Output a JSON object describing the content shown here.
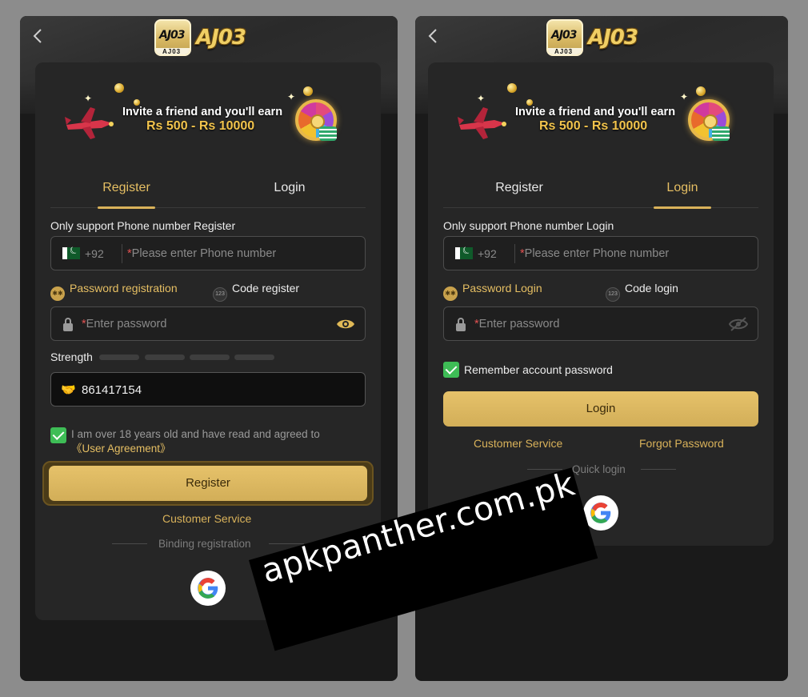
{
  "colors": {
    "gold": "#d9b25a",
    "card": "#262626",
    "check": "#3ebd56"
  },
  "brand": {
    "icon_mark": "AJ03",
    "icon_small": "AJ03",
    "word": "AJ03"
  },
  "banner": {
    "line1": "Invite a friend and you'll earn",
    "line2": "Rs 500 - Rs 10000"
  },
  "register_screen": {
    "tabs": [
      "Register",
      "Login"
    ],
    "active_tab": "Register",
    "support_text": "Only support Phone number Register",
    "country_code": "+92",
    "phone_placeholder_star": "*",
    "phone_placeholder": "Please enter Phone number",
    "mode_password": "Password registration",
    "mode_code": "Code register",
    "password_star": "*",
    "password_placeholder": "Enter password",
    "strength_label": "Strength",
    "invite_code": "861417154",
    "agree_text": "I am over 18 years old and have read and agreed to",
    "agree_link": "《User Agreement》",
    "agree_checked": true,
    "register_button": "Register",
    "customer_service": "Customer Service",
    "binding_label": "Binding registration",
    "google_icon": "google-icon"
  },
  "login_screen": {
    "tabs": [
      "Register",
      "Login"
    ],
    "active_tab": "Login",
    "support_text": "Only support Phone number Login",
    "country_code": "+92",
    "phone_placeholder_star": "*",
    "phone_placeholder": "Please enter Phone number",
    "mode_password": "Password Login",
    "mode_code": "Code login",
    "password_star": "*",
    "password_placeholder": "Enter password",
    "remember_label": "Remember account password",
    "remember_checked": true,
    "login_button": "Login",
    "customer_service": "Customer Service",
    "forgot_password": "Forgot Password",
    "quick_login": "Quick login",
    "google_icon": "google-icon"
  },
  "watermark": "apkpanther.com.pk"
}
